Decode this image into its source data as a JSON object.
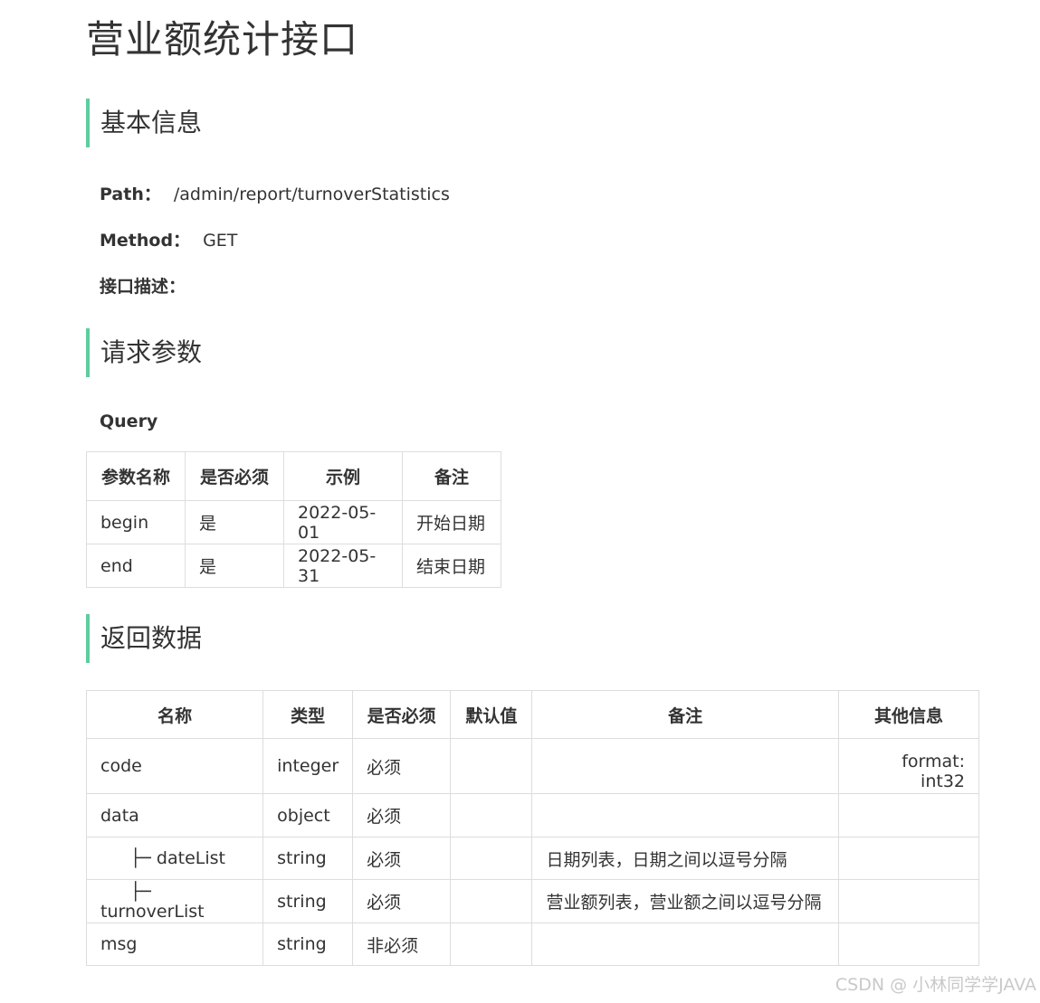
{
  "title": "营业额统计接口",
  "sections": {
    "basic": "基本信息",
    "request": "请求参数",
    "response": "返回数据"
  },
  "info": {
    "path_label": "Path：",
    "path_value": "/admin/report/turnoverStatistics",
    "method_label": "Method：",
    "method_value": "GET",
    "desc_label": "接口描述："
  },
  "query": {
    "label": "Query",
    "headers": [
      "参数名称",
      "是否必须",
      "示例",
      "备注"
    ],
    "rows": [
      [
        "begin",
        "是",
        "2022-05-01",
        "开始日期"
      ],
      [
        "end",
        "是",
        "2022-05-31",
        "结束日期"
      ]
    ]
  },
  "response": {
    "headers": [
      "名称",
      "类型",
      "是否必须",
      "默认值",
      "备注",
      "其他信息"
    ],
    "rows": [
      {
        "name": "code",
        "type": "integer",
        "required": "必须",
        "default": "",
        "remark": "",
        "other": "format: int32"
      },
      {
        "name": "data",
        "type": "object",
        "required": "必须",
        "default": "",
        "remark": "",
        "other": ""
      },
      {
        "name": "├─ dateList",
        "type": "string",
        "required": "必须",
        "default": "",
        "remark": "日期列表，日期之间以逗号分隔",
        "other": ""
      },
      {
        "name": "├─ turnoverList",
        "type": "string",
        "required": "必须",
        "default": "",
        "remark": "营业额列表，营业额之间以逗号分隔",
        "other": ""
      },
      {
        "name": "msg",
        "type": "string",
        "required": "非必须",
        "default": "",
        "remark": "",
        "other": ""
      }
    ]
  },
  "watermark": "CSDN @ 小林同学学JAVA"
}
